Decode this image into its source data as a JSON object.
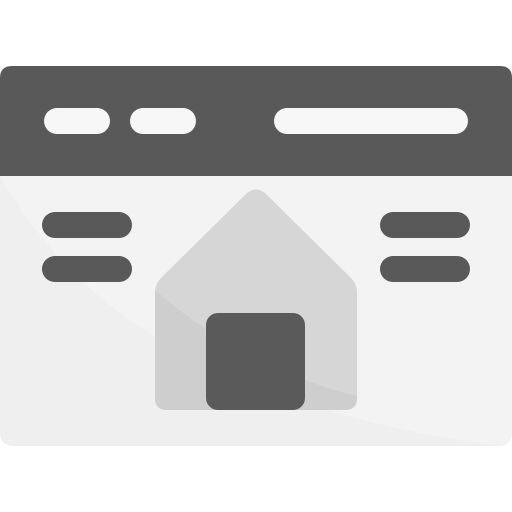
{
  "icon": {
    "name": "browser-homepage-icon",
    "colors": {
      "frame_dark": "#595959",
      "body_light": "#efefef",
      "body_lighter": "#f6f6f6",
      "pill_light": "#f7f7f7",
      "menu_dark": "#595959",
      "house_light": "#d6d6d6",
      "house_shadow": "#c9c9c9",
      "door_dark": "#5a5a5a"
    }
  }
}
